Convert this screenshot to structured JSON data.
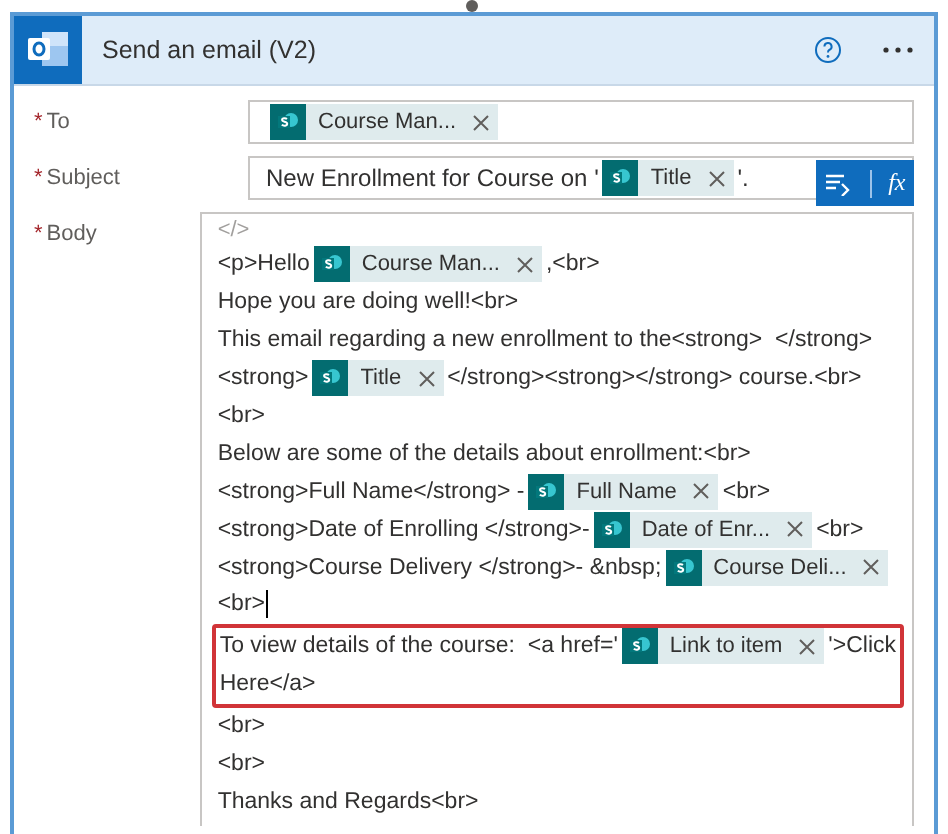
{
  "header": {
    "title": "Send an email (V2)"
  },
  "fields": [
    {
      "label": "To",
      "required_mark": "*",
      "segments": [
        {
          "kind": "token",
          "label": "Course Man..."
        }
      ]
    },
    {
      "label": "Subject",
      "required_mark": "*",
      "segments": [
        {
          "kind": "text",
          "text": "New Enrollment for Course on '"
        },
        {
          "kind": "token",
          "label": "Title"
        },
        {
          "kind": "text",
          "text": "'."
        }
      ],
      "actions": {
        "fx": "fx"
      }
    }
  ],
  "body": {
    "label": "Body",
    "required_mark": "*",
    "code_toggle": "</>",
    "blocks": [
      {
        "highlighted": false,
        "lines": [
          {
            "cursor": false,
            "segments": [
              {
                "kind": "text",
                "text": "<p>Hello"
              },
              {
                "kind": "token",
                "label": "Course Man..."
              },
              {
                "kind": "text",
                "text": ",<br>"
              }
            ]
          },
          {
            "cursor": false,
            "segments": [
              {
                "kind": "text",
                "text": "Hope you are doing well!<br>"
              }
            ]
          },
          {
            "cursor": false,
            "segments": [
              {
                "kind": "text",
                "text": "This email regarding a new enrollment to the<strong>  </strong>"
              }
            ]
          },
          {
            "cursor": false,
            "segments": [
              {
                "kind": "text",
                "text": "<strong>"
              },
              {
                "kind": "token",
                "label": "Title"
              },
              {
                "kind": "text",
                "text": "</strong><strong></strong> course.<br>"
              }
            ]
          },
          {
            "cursor": false,
            "segments": [
              {
                "kind": "text",
                "text": "<br>"
              }
            ]
          },
          {
            "cursor": false,
            "segments": [
              {
                "kind": "text",
                "text": "Below are some of the details about enrollment:<br>"
              }
            ]
          },
          {
            "cursor": false,
            "segments": [
              {
                "kind": "text",
                "text": "<strong>Full Name</strong> -"
              },
              {
                "kind": "token",
                "label": "Full Name"
              },
              {
                "kind": "text",
                "text": "<br>"
              }
            ]
          },
          {
            "cursor": false,
            "segments": [
              {
                "kind": "text",
                "text": "<strong>Date of Enrolling </strong>-"
              },
              {
                "kind": "token",
                "label": "Date of Enr..."
              },
              {
                "kind": "text",
                "text": "<br>"
              }
            ]
          },
          {
            "cursor": false,
            "segments": [
              {
                "kind": "text",
                "text": "<strong>Course Delivery </strong>- &nbsp;"
              },
              {
                "kind": "token",
                "label": "Course Deli..."
              }
            ]
          },
          {
            "cursor": true,
            "segments": [
              {
                "kind": "text",
                "text": "<br>"
              }
            ]
          }
        ]
      },
      {
        "highlighted": true,
        "lines": [
          {
            "cursor": false,
            "segments": [
              {
                "kind": "text",
                "text": "To view details of the course:  <a href='"
              },
              {
                "kind": "token",
                "label": "Link to item"
              },
              {
                "kind": "text",
                "text": "'>Click"
              }
            ]
          },
          {
            "cursor": false,
            "segments": [
              {
                "kind": "text",
                "text": "Here</a>"
              }
            ]
          }
        ]
      },
      {
        "highlighted": false,
        "lines": [
          {
            "cursor": false,
            "segments": [
              {
                "kind": "text",
                "text": "<br>"
              }
            ]
          },
          {
            "cursor": false,
            "segments": [
              {
                "kind": "text",
                "text": "<br>"
              }
            ]
          },
          {
            "cursor": false,
            "segments": [
              {
                "kind": "text",
                "text": "Thanks and Regards<br>"
              }
            ]
          }
        ]
      }
    ]
  }
}
